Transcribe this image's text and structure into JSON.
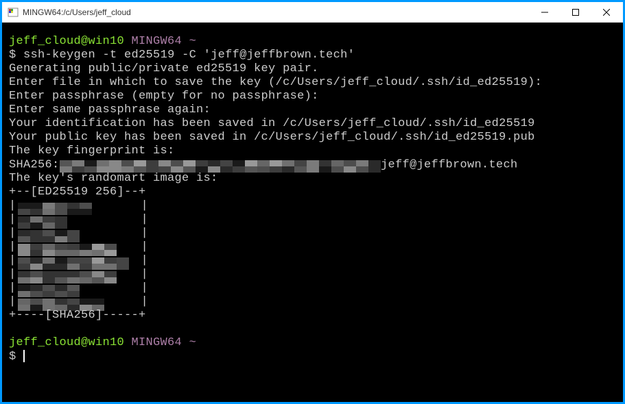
{
  "window": {
    "title": "MINGW64:/c/Users/jeff_cloud"
  },
  "prompt": {
    "user_host": "jeff_cloud@win10",
    "env": "MINGW64",
    "path": "~",
    "dollar": "$"
  },
  "command": "ssh-keygen -t ed25519 -C 'jeff@jeffbrown.tech'",
  "output": {
    "line1": "Generating public/private ed25519 key pair.",
    "line2": "Enter file in which to save the key (/c/Users/jeff_cloud/.ssh/id_ed25519):",
    "line3": "Enter passphrase (empty for no passphrase):",
    "line4": "Enter same passphrase again:",
    "line5": "Your identification has been saved in /c/Users/jeff_cloud/.ssh/id_ed25519",
    "line6": "Your public key has been saved in /c/Users/jeff_cloud/.ssh/id_ed25519.pub",
    "line7": "The key fingerprint is:",
    "sha_prefix": "SHA256:",
    "sha_suffix": " jeff@jeffbrown.tech",
    "line8": "The key's randomart image is:",
    "ra_top": "+--[ED25519 256]--+",
    "ra_left": "|",
    "ra_right": "|",
    "ra_bottom": "+----[SHA256]-----+"
  }
}
